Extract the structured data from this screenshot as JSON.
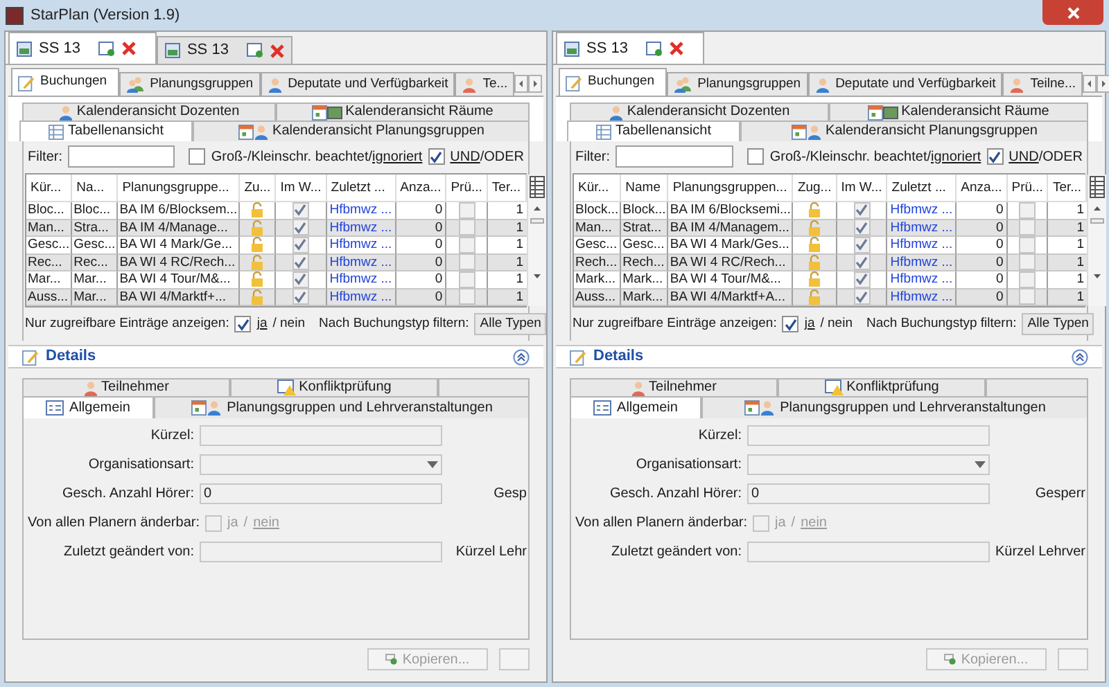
{
  "window": {
    "title": "StarPlan (Version 1.9)"
  },
  "panels": [
    {
      "doc_tabs": [
        {
          "label": "SS 13",
          "selected": true
        },
        {
          "label": "SS 13",
          "selected": false
        }
      ],
      "main_tabs": [
        {
          "label": "Buchungen",
          "kind": "booking",
          "selected": true
        },
        {
          "label": "Planungsgruppen",
          "kind": "group",
          "selected": false
        },
        {
          "label": "Deputate und Verfügbarkeit",
          "kind": "lecturer",
          "selected": false
        },
        {
          "label": "Te...",
          "kind": "participant",
          "selected": false
        }
      ],
      "view_tabs_back": [
        {
          "label": "Kalenderansicht Dozenten",
          "kind": "lecturer"
        },
        {
          "label": "Kalenderansicht Räume",
          "kind": "room"
        }
      ],
      "view_tabs_front": [
        {
          "label": "Tabellenansicht",
          "kind": "table",
          "selected": true
        },
        {
          "label": "Kalenderansicht Planungsgruppen",
          "kind": "group",
          "selected": false
        }
      ],
      "filter": {
        "label": "Filter:",
        "case_label": "Groß-/Kleinschr. beachtet/",
        "case_link": "ignoriert",
        "case_checked": false,
        "logic_link": "UND",
        "logic_label": "/ODER",
        "logic_checked": true
      },
      "table": {
        "columns": [
          "Kür...",
          "Na...",
          "Planungsgruppe...",
          "Zu...",
          "Im W...",
          "Zuletzt ...",
          "Anza...",
          "Prü...",
          "Ter..."
        ],
        "rows": [
          {
            "kuerzel": "Bloc...",
            "name": "Bloc...",
            "gruppe": "BA IM 6/Blocksem...",
            "im_w": true,
            "zuletzt": "Hfbmwz ...",
            "anzahl": "0",
            "pruef": false,
            "termine": "1"
          },
          {
            "kuerzel": "Man...",
            "name": "Stra...",
            "gruppe": "BA IM 4/Manage...",
            "im_w": true,
            "zuletzt": "Hfbmwz ...",
            "anzahl": "0",
            "pruef": false,
            "termine": "1"
          },
          {
            "kuerzel": "Gesc...",
            "name": "Gesc...",
            "gruppe": "BA WI 4 Mark/Ge...",
            "im_w": true,
            "zuletzt": "Hfbmwz ...",
            "anzahl": "0",
            "pruef": false,
            "termine": "1"
          },
          {
            "kuerzel": "Rec...",
            "name": "Rec...",
            "gruppe": "BA WI 4 RC/Rech...",
            "im_w": true,
            "zuletzt": "Hfbmwz ...",
            "anzahl": "0",
            "pruef": false,
            "termine": "1"
          },
          {
            "kuerzel": "Mar...",
            "name": "Mar...",
            "gruppe": "BA WI 4 Tour/M&...",
            "im_w": true,
            "zuletzt": "Hfbmwz ...",
            "anzahl": "0",
            "pruef": false,
            "termine": "1"
          },
          {
            "kuerzel": "Auss...",
            "name": "Mar...",
            "gruppe": "BA WI 4/Marktf+...",
            "im_w": true,
            "zuletzt": "Hfbmwz ...",
            "anzahl": "0",
            "pruef": false,
            "termine": "1"
          }
        ]
      },
      "access": {
        "label": "Nur zugreifbare Einträge anzeigen:",
        "checked": true,
        "yes": "ja",
        "no": "/ nein",
        "type_label": "Nach Buchungstyp filtern:",
        "type_value": "Alle Typen"
      },
      "details": {
        "title": "Details",
        "tabs_back": [
          {
            "label": "Teilnehmer",
            "kind": "participant"
          },
          {
            "label": "Konfliktprüfung",
            "kind": "warning"
          }
        ],
        "tabs_front": [
          {
            "label": "Allgemein",
            "kind": "form",
            "selected": true
          },
          {
            "label": "Planungsgruppen und Lehrveranstaltungen",
            "kind": "group",
            "selected": false
          }
        ],
        "kuerzel_label": "Kürzel:",
        "org_label": "Organisationsart:",
        "hoerer_label": "Gesch. Anzahl Hörer:",
        "hoerer_value": "0",
        "hoerer_side": "Gesp",
        "editable_label": "Von allen Planern änderbar:",
        "editable_checked": false,
        "editable_yes": "ja",
        "editable_sep": "/",
        "editable_no": "nein",
        "changed_label": "Zuletzt geändert von:",
        "changed_side": "Kürzel Lehr",
        "copy_button": "Kopieren..."
      }
    },
    {
      "doc_tabs": [
        {
          "label": "SS 13",
          "selected": true
        }
      ],
      "main_tabs": [
        {
          "label": "Buchungen",
          "kind": "booking",
          "selected": true
        },
        {
          "label": "Planungsgruppen",
          "kind": "group",
          "selected": false
        },
        {
          "label": "Deputate und Verfügbarkeit",
          "kind": "lecturer",
          "selected": false
        },
        {
          "label": "Teilne...",
          "kind": "participant",
          "selected": false
        }
      ],
      "view_tabs_back": [
        {
          "label": "Kalenderansicht Dozenten",
          "kind": "lecturer"
        },
        {
          "label": "Kalenderansicht Räume",
          "kind": "room"
        }
      ],
      "view_tabs_front": [
        {
          "label": "Tabellenansicht",
          "kind": "table",
          "selected": true
        },
        {
          "label": "Kalenderansicht Planungsgruppen",
          "kind": "group",
          "selected": false
        }
      ],
      "filter": {
        "label": "Filter:",
        "case_label": "Groß-/Kleinschr. beachtet/",
        "case_link": "ignoriert",
        "case_checked": false,
        "logic_link": "UND",
        "logic_label": "/ODER",
        "logic_checked": true
      },
      "table": {
        "columns": [
          "Kür...",
          "Name",
          "Planungsgruppen...",
          "Zug...",
          "Im W...",
          "Zuletzt ...",
          "Anza...",
          "Prü...",
          "Ter..."
        ],
        "rows": [
          {
            "kuerzel": "Block...",
            "name": "Block...",
            "gruppe": "BA IM 6/Blocksemi...",
            "im_w": true,
            "zuletzt": "Hfbmwz ...",
            "anzahl": "0",
            "pruef": false,
            "termine": "1"
          },
          {
            "kuerzel": "Man...",
            "name": "Strat...",
            "gruppe": "BA IM 4/Managem...",
            "im_w": true,
            "zuletzt": "Hfbmwz ...",
            "anzahl": "0",
            "pruef": false,
            "termine": "1"
          },
          {
            "kuerzel": "Gesc...",
            "name": "Gesc...",
            "gruppe": "BA WI 4 Mark/Ges...",
            "im_w": true,
            "zuletzt": "Hfbmwz ...",
            "anzahl": "0",
            "pruef": false,
            "termine": "1"
          },
          {
            "kuerzel": "Rech...",
            "name": "Rech...",
            "gruppe": "BA WI 4 RC/Rech...",
            "im_w": true,
            "zuletzt": "Hfbmwz ...",
            "anzahl": "0",
            "pruef": false,
            "termine": "1"
          },
          {
            "kuerzel": "Mark...",
            "name": "Mark...",
            "gruppe": "BA WI 4 Tour/M&...",
            "im_w": true,
            "zuletzt": "Hfbmwz ...",
            "anzahl": "0",
            "pruef": false,
            "termine": "1"
          },
          {
            "kuerzel": "Auss...",
            "name": "Mark...",
            "gruppe": "BA WI 4/Marktf+A...",
            "im_w": true,
            "zuletzt": "Hfbmwz ...",
            "anzahl": "0",
            "pruef": false,
            "termine": "1"
          }
        ]
      },
      "access": {
        "label": "Nur zugreifbare Einträge anzeigen:",
        "checked": true,
        "yes": "ja",
        "no": "/ nein",
        "type_label": "Nach Buchungstyp filtern:",
        "type_value": "Alle Typen"
      },
      "details": {
        "title": "Details",
        "tabs_back": [
          {
            "label": "Teilnehmer",
            "kind": "participant"
          },
          {
            "label": "Konfliktprüfung",
            "kind": "warning"
          }
        ],
        "tabs_front": [
          {
            "label": "Allgemein",
            "kind": "form",
            "selected": true
          },
          {
            "label": "Planungsgruppen und Lehrveranstaltungen",
            "kind": "group",
            "selected": false
          }
        ],
        "kuerzel_label": "Kürzel:",
        "org_label": "Organisationsart:",
        "hoerer_label": "Gesch. Anzahl Hörer:",
        "hoerer_value": "0",
        "hoerer_side": "Gesperr",
        "editable_label": "Von allen Planern änderbar:",
        "editable_checked": false,
        "editable_yes": "ja",
        "editable_sep": "/",
        "editable_no": "nein",
        "changed_label": "Zuletzt geändert von:",
        "changed_side": "Kürzel Lehrver",
        "copy_button": "Kopieren..."
      }
    }
  ]
}
